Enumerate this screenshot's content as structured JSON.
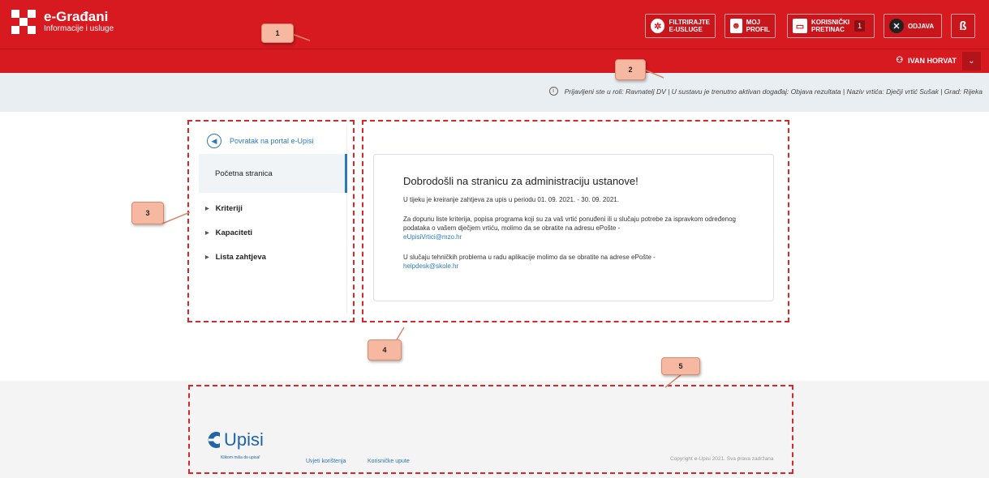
{
  "header": {
    "logo_title": "e-Građani",
    "logo_subtitle": "Informacije i usluge",
    "buttons": [
      {
        "icon": "filter-icon",
        "label_line1": "Filtrirajte",
        "label_line2": "e-usluge"
      },
      {
        "icon": "profile-icon",
        "label_line1": "Moj",
        "label_line2": "profil"
      },
      {
        "icon": "inbox-icon",
        "label_line1": "Korisnički",
        "label_line2": "pretinac",
        "count": "1"
      },
      {
        "icon": "close-icon",
        "label_line1": "Odjava"
      },
      {
        "icon": "accessibility-icon",
        "symbol": "ß"
      }
    ],
    "user_name": "IVAN HORVAT"
  },
  "info_text": "Prijavljeni ste u roli: Ravnatelj DV | U sustavu je trenutno aktivan događaj: Objava rezultata | Naziv vrtića: Dječji vrtić Sušak | Grad: Rijeka",
  "sidebar": {
    "back_label": "Povratak na portal e-Upisi",
    "home_label": "Početna stranica",
    "items": [
      {
        "label": "Kriteriji"
      },
      {
        "label": "Kapaciteti"
      },
      {
        "label": "Lista zahtjeva"
      }
    ]
  },
  "main": {
    "title": "Dobrodošli na stranicu za administraciju ustanove!",
    "p1": "U tijeku je kreiranje zahtjeva za upis u periodu 01. 09. 2021. - 30. 09. 2021.",
    "p2": "Za dopunu liste kriterija, popisa programa koji su za vaš vrtić ponuđeni ili u slučaju potrebe za ispravkom određenog podataka o vašem dječjem vrtiću, molimo da se obratite na adresu ePošte -",
    "p2_link": "eUpisiVrtici@mzo.hr",
    "p3": "U slučaju tehničkih problema u radu aplikacije molimo da se obratite na adrese ePošte -",
    "p3_link": "helpdesk@skole.hr"
  },
  "footer": {
    "logo_word": "Upisi",
    "logo_tagline": "Klikom miša do upisa!",
    "links": [
      "Uvjeti korištenja",
      "Korisničke upute"
    ],
    "copyright": "Copyright e-Upisi 2021. Sva prava zadržana"
  },
  "callouts": [
    "1",
    "2",
    "3",
    "4",
    "5"
  ],
  "colors": {
    "brand_red": "#d71920",
    "link_blue": "#2a7ab8",
    "annotation_red": "#d62828",
    "callout_fill": "#f6b8a0"
  }
}
